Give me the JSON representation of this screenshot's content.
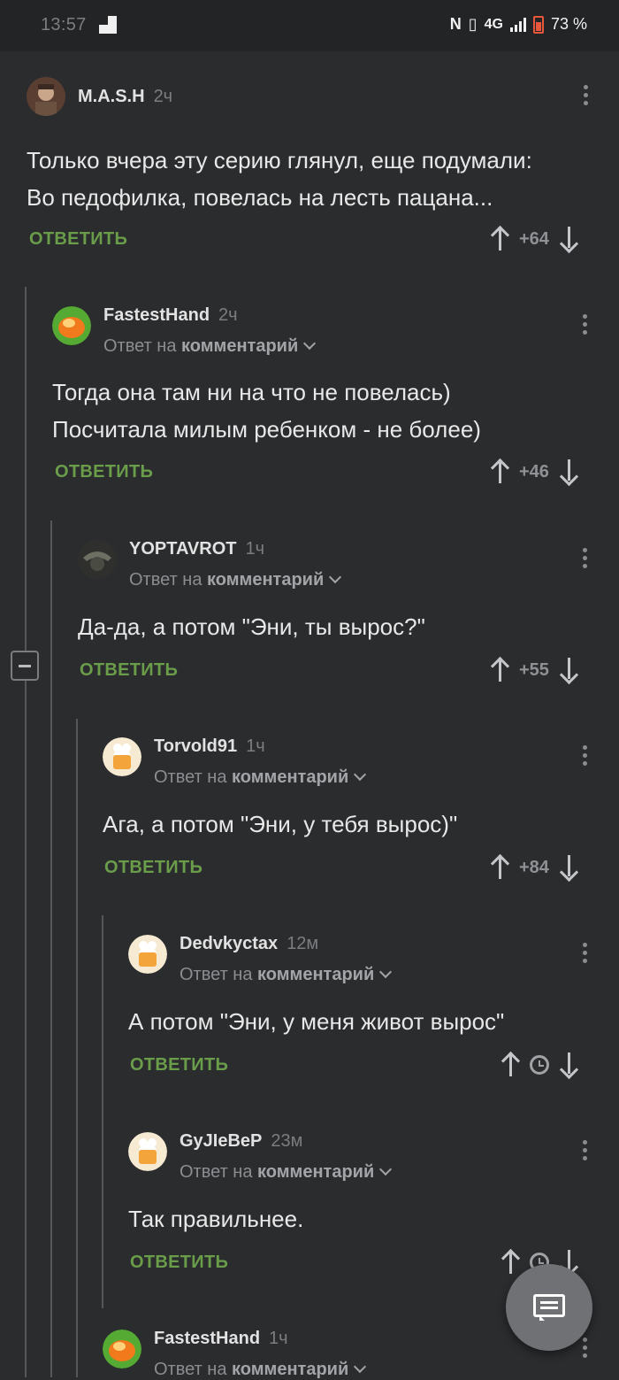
{
  "status": {
    "time": "13:57",
    "network": "4G",
    "battery": "73 %"
  },
  "reply_to_prefix": "Ответ на",
  "reply_to_link": "комментарий",
  "comments": [
    {
      "author": "M.A.S.H",
      "time": "2ч",
      "text_lines": [
        "Только вчера эту серию глянул, еще подумали:",
        "Во педофилка, повелась на лесть пацана..."
      ],
      "reply": "ОТВЕТИТЬ",
      "score": "+64"
    },
    {
      "author": "FastestHand",
      "time": "2ч",
      "text_lines": [
        "Тогда она там ни на что не повелась)",
        "Посчитала милым ребенком - не более)"
      ],
      "reply": "ОТВЕТИТЬ",
      "score": "+46"
    },
    {
      "author": "YOPTAVROT",
      "time": "1ч",
      "text_lines": [
        "Да-да, а потом \"Эни, ты вырос?\""
      ],
      "reply": "ОТВЕТИТЬ",
      "score": "+55"
    },
    {
      "author": "Torvold91",
      "time": "1ч",
      "text_lines": [
        "Ага, а потом \"Эни, у тебя вырос)\""
      ],
      "reply": "ОТВЕТИТЬ",
      "score": "+84"
    },
    {
      "author": "Dedvkyctax",
      "time": "12м",
      "text_lines": [
        "А потом \"Эни, у меня живот вырос\""
      ],
      "reply": "ОТВЕТИТЬ",
      "score": ""
    },
    {
      "author": "GyJIeBeP",
      "time": "23м",
      "text_lines": [
        "Так правильнее."
      ],
      "reply": "ОТВЕТИТЬ",
      "score": ""
    },
    {
      "author": "FastestHand",
      "time": "1ч",
      "text_lines": [],
      "reply": "",
      "score": ""
    }
  ],
  "colors": {
    "background": "#2b2c2e",
    "reply": "#6a9d4a",
    "thread_line": "#55575b"
  },
  "icons": [
    "nfc-icon",
    "vibrate-icon",
    "signal-icon",
    "battery-icon",
    "kebab-menu-icon",
    "upvote-icon",
    "downvote-icon",
    "clock-icon",
    "collapse-icon",
    "chat-icon"
  ]
}
